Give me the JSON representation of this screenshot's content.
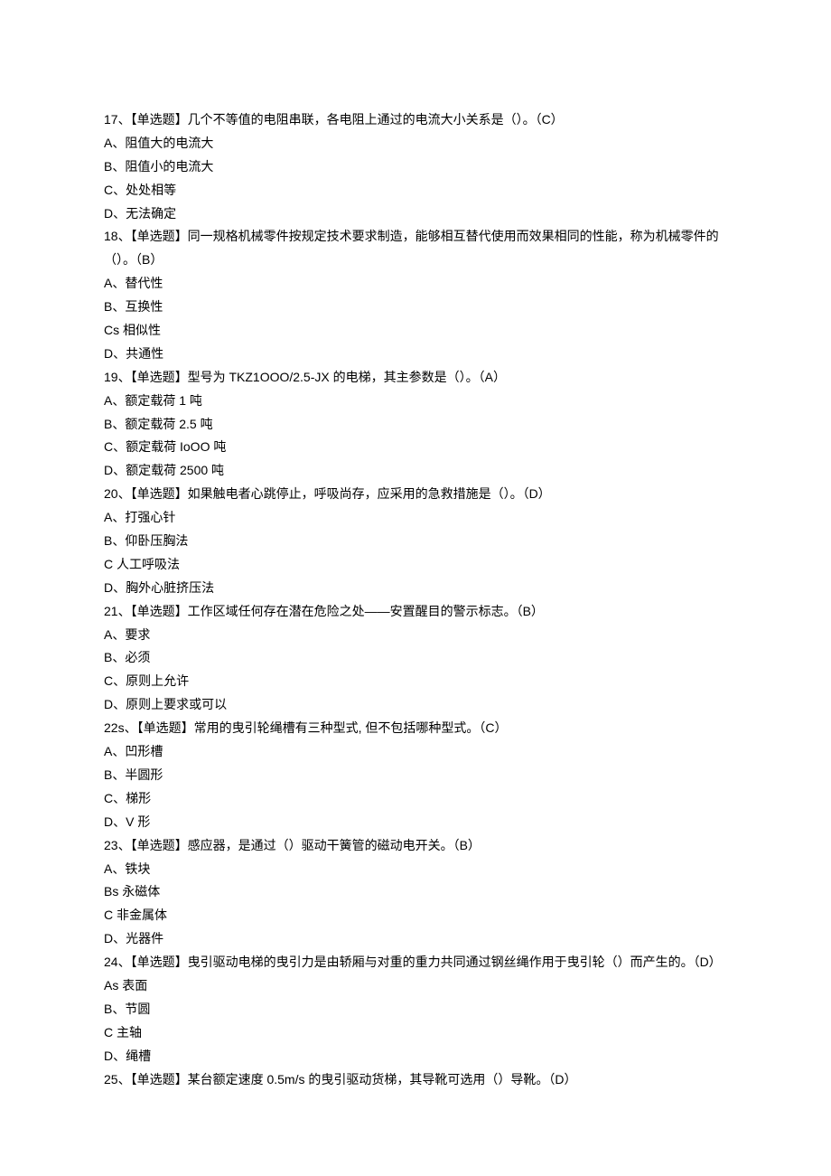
{
  "questions": [
    {
      "num": "17",
      "stem": "【单选题】几个不等值的电阻串联，各电阻上通过的电流大小关系是（）。（C）",
      "options": [
        "A、阻值大的电流大",
        "B、阻值小的电流大",
        "C、处处相等",
        "D、无法确定"
      ]
    },
    {
      "num": "18",
      "stem": "【单选题】同一规格机械零件按规定技术要求制造，能够相互替代使用而效果相同的性能，称为机械零件的（）。（B）",
      "options": [
        "A、替代性",
        "B、互换性",
        "Cs 相似性",
        "D、共通性"
      ]
    },
    {
      "num": "19",
      "stem": "【单选题】型号为 TKZ1OOO/2.5-JX 的电梯，其主参数是（）。（A）",
      "options": [
        "A、额定载荷 1 吨",
        "B、额定载荷 2.5 吨",
        "C、额定载荷 IoOO 吨",
        "D、额定载荷 2500 吨"
      ]
    },
    {
      "num": "20",
      "stem": "【单选题】如果触电者心跳停止，呼吸尚存，应采用的急救措施是（）。（D）",
      "options": [
        "A、打强心针",
        "B、仰卧压胸法",
        "C 人工呼吸法",
        "D、胸外心脏挤压法"
      ]
    },
    {
      "num": "21",
      "stem": "【单选题】工作区域任何存在潜在危险之处——安置醒目的警示标志。（B）",
      "options": [
        "A、要求",
        "B、必须",
        "C、原则上允许",
        "D、原则上要求或可以"
      ]
    },
    {
      "num": "22s",
      "stem": "【单选题】常用的曳引轮绳槽有三种型式, 但不包括哪种型式。（C）",
      "options": [
        "A、凹形槽",
        "B、半圆形",
        "C、梯形",
        "D、V 形"
      ]
    },
    {
      "num": "23",
      "stem": "【单选题】感应器，是通过（）驱动干簧管的磁动电开关。（B）",
      "options": [
        "A、铁块",
        "Bs 永磁体",
        "C 非金属体",
        "D、光器件"
      ]
    },
    {
      "num": "24",
      "stem": "【单选题】曳引驱动电梯的曳引力是由轿厢与对重的重力共同通过钢丝绳作用于曳引轮（）而产生的。（D）",
      "options": [
        "As 表面",
        "B、节圆",
        "C 主轴",
        "D、绳槽"
      ]
    },
    {
      "num": "25",
      "stem": "【单选题】某台额定速度 0.5m/s 的曳引驱动货梯，其导靴可选用（）导靴。（D）",
      "options": []
    }
  ]
}
